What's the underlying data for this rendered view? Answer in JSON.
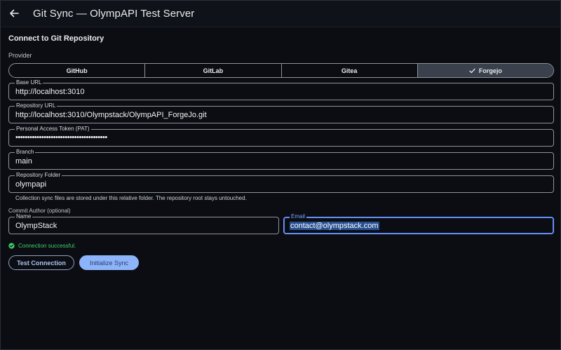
{
  "window": {
    "title": "Git Sync — OlympAPI Test Server"
  },
  "form": {
    "section_title": "Connect to Git Repository",
    "provider_label": "Provider",
    "providers": [
      {
        "label": "GitHub",
        "selected": false
      },
      {
        "label": "GitLab",
        "selected": false
      },
      {
        "label": "Gitea",
        "selected": false
      },
      {
        "label": "Forgejo",
        "selected": true
      }
    ],
    "fields": {
      "base_url": {
        "label": "Base URL",
        "value": "http://localhost:3010"
      },
      "repo_url": {
        "label": "Repository URL",
        "value": "http://localhost:3010/Olympstack/OlympAPI_ForgeJo.git"
      },
      "pat": {
        "label": "Personal Access Token (PAT)",
        "value": "•••••••••••••••••••••••••••••••••••••••"
      },
      "branch": {
        "label": "Branch",
        "value": "main"
      },
      "folder": {
        "label": "Repository Folder",
        "value": "olympapi"
      }
    },
    "folder_helper": "Collection sync files are stored under this relative folder. The repository root stays untouched.",
    "commit_author_label": "Commit Author (optional)",
    "author_name": {
      "label": "Name",
      "value": "OlympStack"
    },
    "author_email": {
      "label": "Email",
      "value": "contact@olympstack.com"
    },
    "status_text": "Connection successful.",
    "test_button": "Test Connection",
    "init_button": "Initialize Sync"
  },
  "colors": {
    "background": "#0b0d12",
    "accent": "#8db4fb",
    "success": "#3fcf6a",
    "focus": "#6e9bff"
  },
  "icons": {
    "back": "arrow-left-icon",
    "selected": "check-icon",
    "status": "check-circle-icon"
  }
}
